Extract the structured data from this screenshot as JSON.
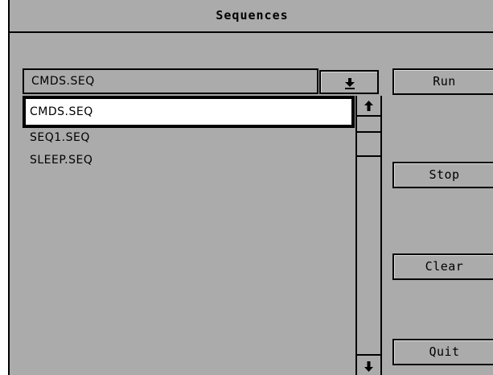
{
  "window": {
    "title": "Sequences"
  },
  "combo": {
    "value": "CMDS.SEQ",
    "button_icon": "arrow-down-to-bar-icon"
  },
  "list": {
    "items": [
      {
        "label": "CMDS.SEQ",
        "selected": true
      },
      {
        "label": "SEQ1.SEQ",
        "selected": false
      },
      {
        "label": "SLEEP.SEQ",
        "selected": false
      }
    ]
  },
  "scrollbar": {
    "up_icon": "arrow-up-icon",
    "down_icon": "arrow-down-icon"
  },
  "buttons": {
    "run": "Run",
    "stop": "Stop",
    "clear": "Clear",
    "quit": "Quit"
  },
  "colors": {
    "background": "#ababab",
    "selection": "#ffffff",
    "border": "#000000"
  }
}
